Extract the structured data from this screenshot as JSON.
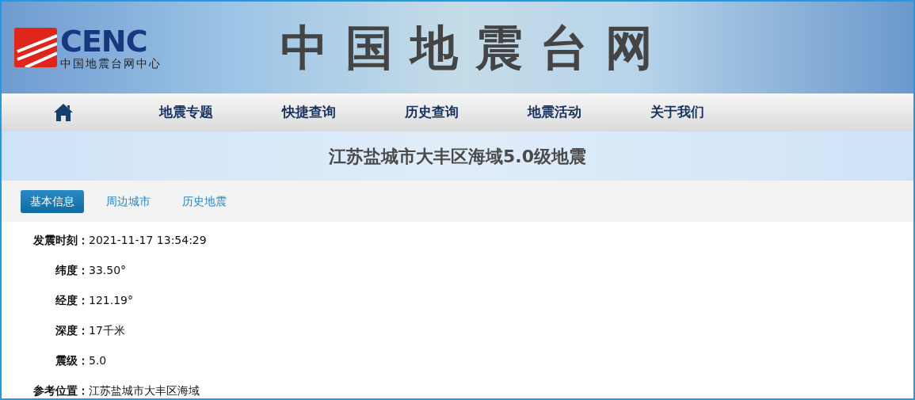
{
  "header": {
    "logo_text": "CENC",
    "logo_subtitle": "中国地震台网中心",
    "site_title": "中国地震台网"
  },
  "nav": [
    {
      "kind": "home"
    },
    {
      "kind": "text",
      "label": "地震专题"
    },
    {
      "kind": "text",
      "label": "快捷查询"
    },
    {
      "kind": "text",
      "label": "历史查询"
    },
    {
      "kind": "text",
      "label": "地震活动"
    },
    {
      "kind": "text",
      "label": "关于我们"
    }
  ],
  "page_title": "江苏盐城市大丰区海域5.0级地震",
  "tabs": [
    {
      "label": "基本信息",
      "selected": true
    },
    {
      "label": "周边城市",
      "selected": false
    },
    {
      "label": "历史地震",
      "selected": false
    }
  ],
  "details": [
    {
      "label": "发震时刻：",
      "value": "2021-11-17 13:54:29"
    },
    {
      "label": "纬度：",
      "value": "33.50°"
    },
    {
      "label": "经度：",
      "value": "121.19°"
    },
    {
      "label": "深度：",
      "value": "17千米"
    },
    {
      "label": "震级：",
      "value": "5.0"
    },
    {
      "label": "参考位置：",
      "value": "江苏盐城市大丰区海域"
    }
  ]
}
